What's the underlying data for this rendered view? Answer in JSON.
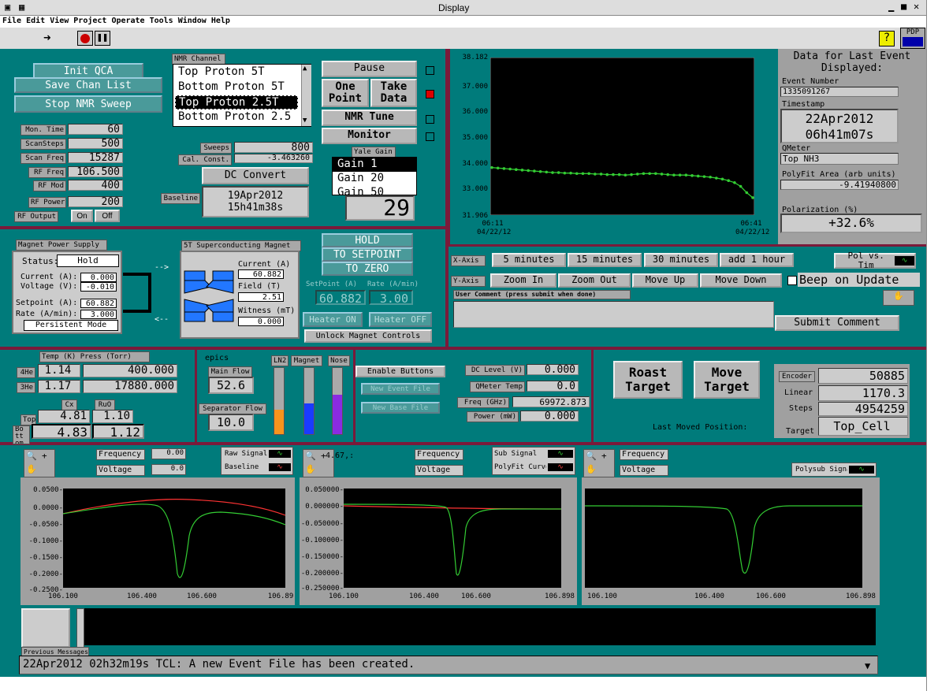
{
  "window": {
    "title": "Display"
  },
  "menu": [
    "File",
    "Edit",
    "View",
    "Project",
    "Operate",
    "Tools",
    "Window",
    "Help"
  ],
  "corner": {
    "label": "PDP"
  },
  "left": {
    "init": "Init QCA",
    "save": "Save Chan List",
    "stop": "Stop NMR Sweep",
    "params": [
      {
        "l": "Mon. Time",
        "v": "60"
      },
      {
        "l": "ScanSteps",
        "v": "500"
      },
      {
        "l": "Scan Freq",
        "v": "15287"
      },
      {
        "l": "RF Freq",
        "v": "106.500"
      },
      {
        "l": "RF Mod",
        "v": "400"
      },
      {
        "l": "RF Power",
        "v": "200"
      }
    ],
    "rfout": "RF Output",
    "on": "On",
    "off": "Off"
  },
  "nmr": {
    "title": "NMR Channel",
    "items": [
      "Top Proton 5T",
      "Bottom Proton 5T",
      "Top Proton 2.5T",
      "Bottom Proton 2.5"
    ],
    "selected": 2,
    "sweeps_l": "Sweeps",
    "sweeps": "800",
    "cal_l": "Cal. Const.",
    "cal": "-3.463260",
    "dc": "DC Convert",
    "base_l": "Baseline",
    "base1": "19Apr2012",
    "base2": "15h41m38s"
  },
  "actions": {
    "pause": "Pause",
    "one": "One Point",
    "take": "Take Data",
    "tune": "NMR Tune",
    "monitor": "Monitor",
    "yale_l": "Yale Gain",
    "gains": [
      "Gain 1",
      "Gain 20",
      "Gain 50"
    ],
    "gainval": "29"
  },
  "top_chart": {
    "y": [
      "38.182",
      "37.000",
      "36.000",
      "35.000",
      "34.000",
      "33.000",
      "31.906"
    ],
    "x0a": "06:11",
    "x0b": "04/22/12",
    "x1a": "06:41",
    "x1b": "04/22/12"
  },
  "chart_data": {
    "type": "line",
    "title": "",
    "xlabel": "",
    "ylabel": "",
    "ylim": [
      31.906,
      38.182
    ],
    "x": [
      "06:11 04/22/12",
      "06:41 04/22/12"
    ],
    "series": [
      {
        "values": [
          33.8,
          33.78,
          33.76,
          33.74,
          33.72,
          33.7,
          33.68,
          33.66,
          33.64,
          33.62,
          33.6,
          33.6,
          33.58,
          33.58,
          33.56,
          33.56,
          33.56,
          33.54,
          33.54,
          33.52,
          33.52,
          33.52,
          33.5,
          33.52,
          33.54,
          33.56,
          33.56,
          33.56,
          33.54,
          33.52,
          33.5,
          33.5,
          33.5,
          33.48,
          33.46,
          33.44,
          33.42,
          33.38,
          33.34,
          33.28,
          33.2,
          33.05,
          32.8,
          32.6
        ]
      }
    ]
  },
  "event": {
    "h1": "Data for Last Event",
    "h2": "Displayed:",
    "num_l": "Event Number",
    "num": "1335091267",
    "ts_l": "Timestamp",
    "ts1": "22Apr2012",
    "ts2": "06h41m07s",
    "qm_l": "QMeter",
    "qm": "Top NH3",
    "pf_l": "PolyFit Area (arb units)",
    "pf": "-9.41940800",
    "pol_l": "Polarization (%)",
    "pol": "+32.6%"
  },
  "axis": {
    "x": "X-Axis",
    "y": "Y-Axis",
    "b5": "5 minutes",
    "b15": "15 minutes",
    "b30": "30 minutes",
    "badd": "add 1 hour",
    "zin": "Zoom In",
    "zout": "Zoom Out",
    "up": "Move Up",
    "down": "Move Down",
    "beep": "Beep on Update",
    "polvs": "Pol vs. Tim",
    "comment_l": "User Comment (press submit when done)",
    "submit": "Submit Comment"
  },
  "magps": {
    "title": "Magnet Power Supply",
    "status_l": "Status:",
    "status": "Hold",
    "cur_l": "Current (A):",
    "cur": "0.000",
    "volt_l": "Voltage (V):",
    "volt": "-0.010",
    "set_l": "Setpoint (A):",
    "set": "60.882",
    "rate_l": "Rate (A/min):",
    "rate": "3.000",
    "mode": "Persistent Mode"
  },
  "magsc": {
    "title": "5T Superconducting Magnet",
    "cur_l": "Current (A)",
    "cur": "60.882",
    "fld_l": "Field (T)",
    "fld": "2.51",
    "wit_l": "Witness (mT)",
    "wit": "0.000"
  },
  "hold": {
    "hold": "HOLD",
    "tosp": "TO SETPOINT",
    "tozero": "TO ZERO",
    "sp_l": "SetPoint (A)",
    "rate_l": "Rate (A/min)",
    "sp": "60.882",
    "rate": "3.00",
    "hon": "Heater ON",
    "hoff": "Heater OFF",
    "unlock": "Unlock Magnet Controls"
  },
  "temp": {
    "title": "Temp (K) Press (Torr)",
    "he4": "4He",
    "he4t": "1.14",
    "he4p": "400.000",
    "he3": "3He",
    "he3t": "1.17",
    "he3p": "17880.000",
    "cx": "Cx",
    "ruo": "RuO",
    "top": "Top",
    "topcx": "4.81",
    "topru": "1.10",
    "bott": "Bottom",
    "botcx": "4.83",
    "botru": "1.12"
  },
  "epics": {
    "title": "epics",
    "main_l": "Main Flow",
    "main": "52.6",
    "sep_l": "Separator Flow",
    "sep": "10.0",
    "ln2": "LN2",
    "magnet": "Magnet",
    "nose": "Nose",
    "ln2_level": 0.37,
    "magnet_level": 0.47,
    "nose_level": 0.6
  },
  "enable": {
    "en": "Enable Buttons",
    "nev": "New Event File",
    "nbase": "New Base File"
  },
  "dc": {
    "dcl": "DC Level (V)",
    "dcv": "0.000",
    "qmt": "QMeter Temp",
    "qmtv": "0.0",
    "freq": "Freq (GHz)",
    "freqv": "69972.873",
    "pow": "Power (mW)",
    "powv": "0.000"
  },
  "target": {
    "roast": "Roast Target",
    "move": "Move Target",
    "lastmoved": "Last Moved Position:",
    "enc_l": "Encoder",
    "enc": "50885",
    "lin_l": "Linear",
    "lin": "1170.3",
    "steps_l": "Steps",
    "steps": "4954259",
    "tgt_l": "Target",
    "tgt": "Top_Cell"
  },
  "plots": {
    "freq": "Frequency",
    "volt": "Voltage",
    "raw": "Raw Signal",
    "baseline": "Baseline",
    "sub": "Sub Signal",
    "polyfit": "PolyFit Curve",
    "polysub": "Polysub Signal",
    "fmt1": "0.00",
    "fmt2": "0.0",
    "ytick": [
      "0.0500-",
      "0.0000-",
      "-0.0500-",
      "-0.1000-",
      "-0.1500-",
      "-0.2000-",
      "-0.2500-"
    ],
    "ytick2": [
      "0.050000-",
      "0.000000-",
      "-0.050000-",
      "-0.100000-",
      "-0.150000-",
      "-0.200000-",
      "-0.250000-"
    ],
    "x1": [
      "106.100",
      "106.400",
      "106.600",
      "106.89"
    ],
    "x2": [
      "106.100",
      "106.400",
      "106.600",
      "106.898"
    ],
    "x3": [
      "106.100",
      "106.400",
      "106.600",
      "106.898"
    ],
    "cursor": "4.67,:"
  },
  "status": {
    "prev": "Previous Messages",
    "msg": "22Apr2012 02h32m19s TCL: A new Event File has been created."
  }
}
